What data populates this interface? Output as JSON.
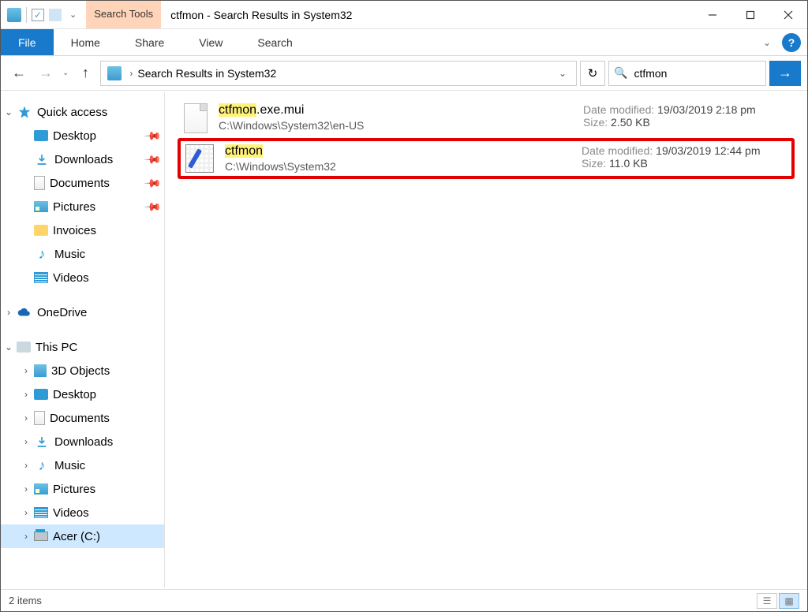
{
  "window": {
    "title": "ctfmon - Search Results in System32",
    "context_tab": "Search Tools"
  },
  "ribbon": {
    "file": "File",
    "home": "Home",
    "share": "Share",
    "view": "View",
    "search": "Search"
  },
  "nav": {
    "breadcrumb": "Search Results in System32",
    "search_value": "ctfmon"
  },
  "sidebar": {
    "quick_access": "Quick access",
    "items_qa": [
      {
        "label": "Desktop",
        "pinned": true,
        "icon": "desktop"
      },
      {
        "label": "Downloads",
        "pinned": true,
        "icon": "down"
      },
      {
        "label": "Documents",
        "pinned": true,
        "icon": "doc"
      },
      {
        "label": "Pictures",
        "pinned": true,
        "icon": "pic"
      },
      {
        "label": "Invoices",
        "pinned": false,
        "icon": "fld"
      },
      {
        "label": "Music",
        "pinned": false,
        "icon": "mus"
      },
      {
        "label": "Videos",
        "pinned": false,
        "icon": "vid"
      }
    ],
    "onedrive": "OneDrive",
    "this_pc": "This PC",
    "items_pc": [
      {
        "label": "3D Objects",
        "icon": "box"
      },
      {
        "label": "Desktop",
        "icon": "desktop"
      },
      {
        "label": "Documents",
        "icon": "doc"
      },
      {
        "label": "Downloads",
        "icon": "down"
      },
      {
        "label": "Music",
        "icon": "mus"
      },
      {
        "label": "Pictures",
        "icon": "pic"
      },
      {
        "label": "Videos",
        "icon": "vid"
      },
      {
        "label": "Acer (C:)",
        "icon": "drive",
        "selected": true
      }
    ]
  },
  "results": [
    {
      "name_hl": "ctfmon",
      "name_rest": ".exe.mui",
      "path": "C:\\Windows\\System32\\en-US",
      "date_label": "Date modified:",
      "date": "19/03/2019 2:18 pm",
      "size_label": "Size:",
      "size": "2.50 KB",
      "icon": "mui",
      "highlighted": false
    },
    {
      "name_hl": "ctfmon",
      "name_rest": "",
      "path": "C:\\Windows\\System32",
      "date_label": "Date modified:",
      "date": "19/03/2019 12:44 pm",
      "size_label": "Size:",
      "size": "11.0 KB",
      "icon": "exe",
      "highlighted": true
    }
  ],
  "status": {
    "count": "2 items"
  }
}
